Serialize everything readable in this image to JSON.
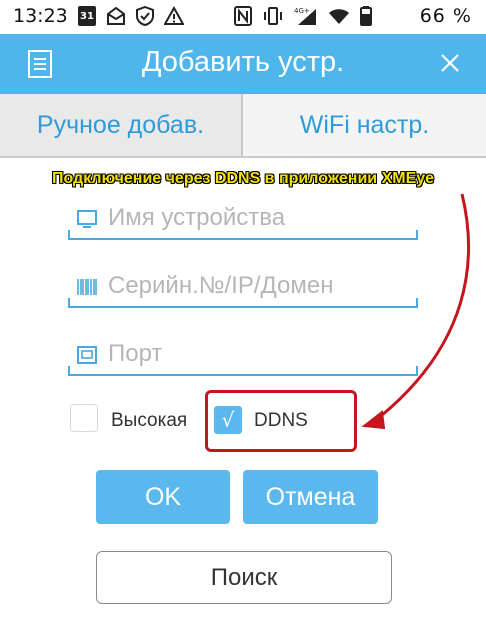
{
  "status_bar": {
    "time": "13:23",
    "calendar_day": "31",
    "battery_text": "66 %",
    "network_label": "4G+"
  },
  "header": {
    "title": "Добавить устр."
  },
  "tabs": [
    {
      "label": "Ручное добав."
    },
    {
      "label": "WiFi настр."
    }
  ],
  "annotation": {
    "text": "Подключение через DDNS в приложении XMEye",
    "color": "#f2e000",
    "highlight_color": "#c4161c"
  },
  "form": {
    "name_placeholder": "Имя устройства",
    "serial_placeholder": "Серийн.№/IP/Домен",
    "port_placeholder": "Порт"
  },
  "options": {
    "high_label": "Высокая",
    "high_checked": false,
    "ddns_label": "DDNS",
    "ddns_checked": true,
    "check_mark": "√"
  },
  "buttons": {
    "ok": "OK",
    "cancel": "Отмена",
    "search": "Поиск"
  },
  "colors": {
    "accent": "#4fb6ec",
    "button": "#5bb8ee",
    "tab_text": "#2f9bd8"
  }
}
